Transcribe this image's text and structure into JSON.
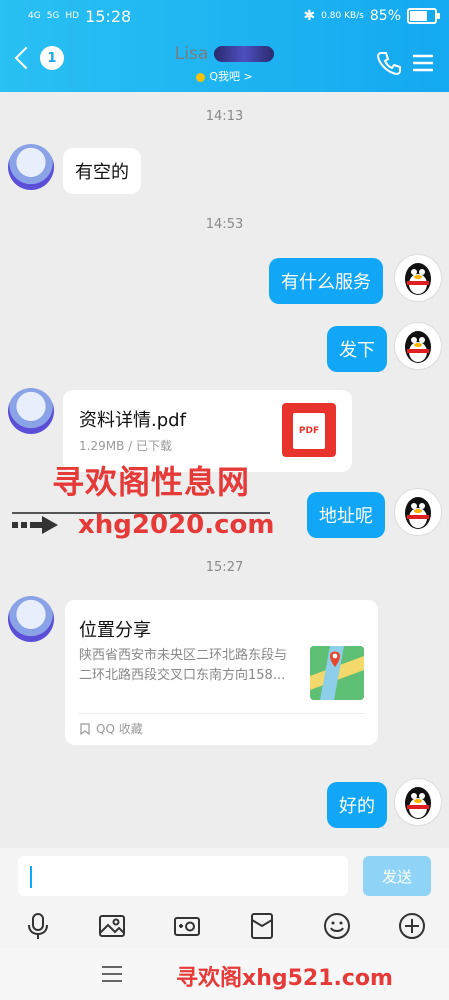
{
  "statusbar": {
    "network": "4G",
    "network2": "5G",
    "hd": "HD",
    "time": "15:28",
    "speed": "0.80 KB/s",
    "battery": "85%",
    "battery_level": 0.85
  },
  "header": {
    "badge": "1",
    "contact_name": "Lisa",
    "status": "Q我吧 >"
  },
  "messages": {
    "t1": "14:13",
    "m1": "有空的",
    "t2": "14:53",
    "m2": "有什么服务",
    "m3": "发下",
    "file": {
      "name": "资料详情.pdf",
      "meta": "1.29MB / 已下载",
      "icon_label": "PDF"
    },
    "m4": "地址呢",
    "t3": "15:27",
    "location": {
      "title": "位置分享",
      "address": "陕西省西安市未央区二环北路东段与二环北路西段交叉口东南方向158...",
      "source": "QQ 收藏"
    },
    "m5": "好的"
  },
  "watermarks": {
    "w1": "寻欢阁性息网",
    "w2": "xhg2020.com",
    "w3": "寻欢阁xhg521.com"
  },
  "input": {
    "value": "",
    "send_label": "发送"
  },
  "colors": {
    "accent": "#12a7f6",
    "header": "#1aa7ef",
    "watermark": "#e63a38"
  }
}
